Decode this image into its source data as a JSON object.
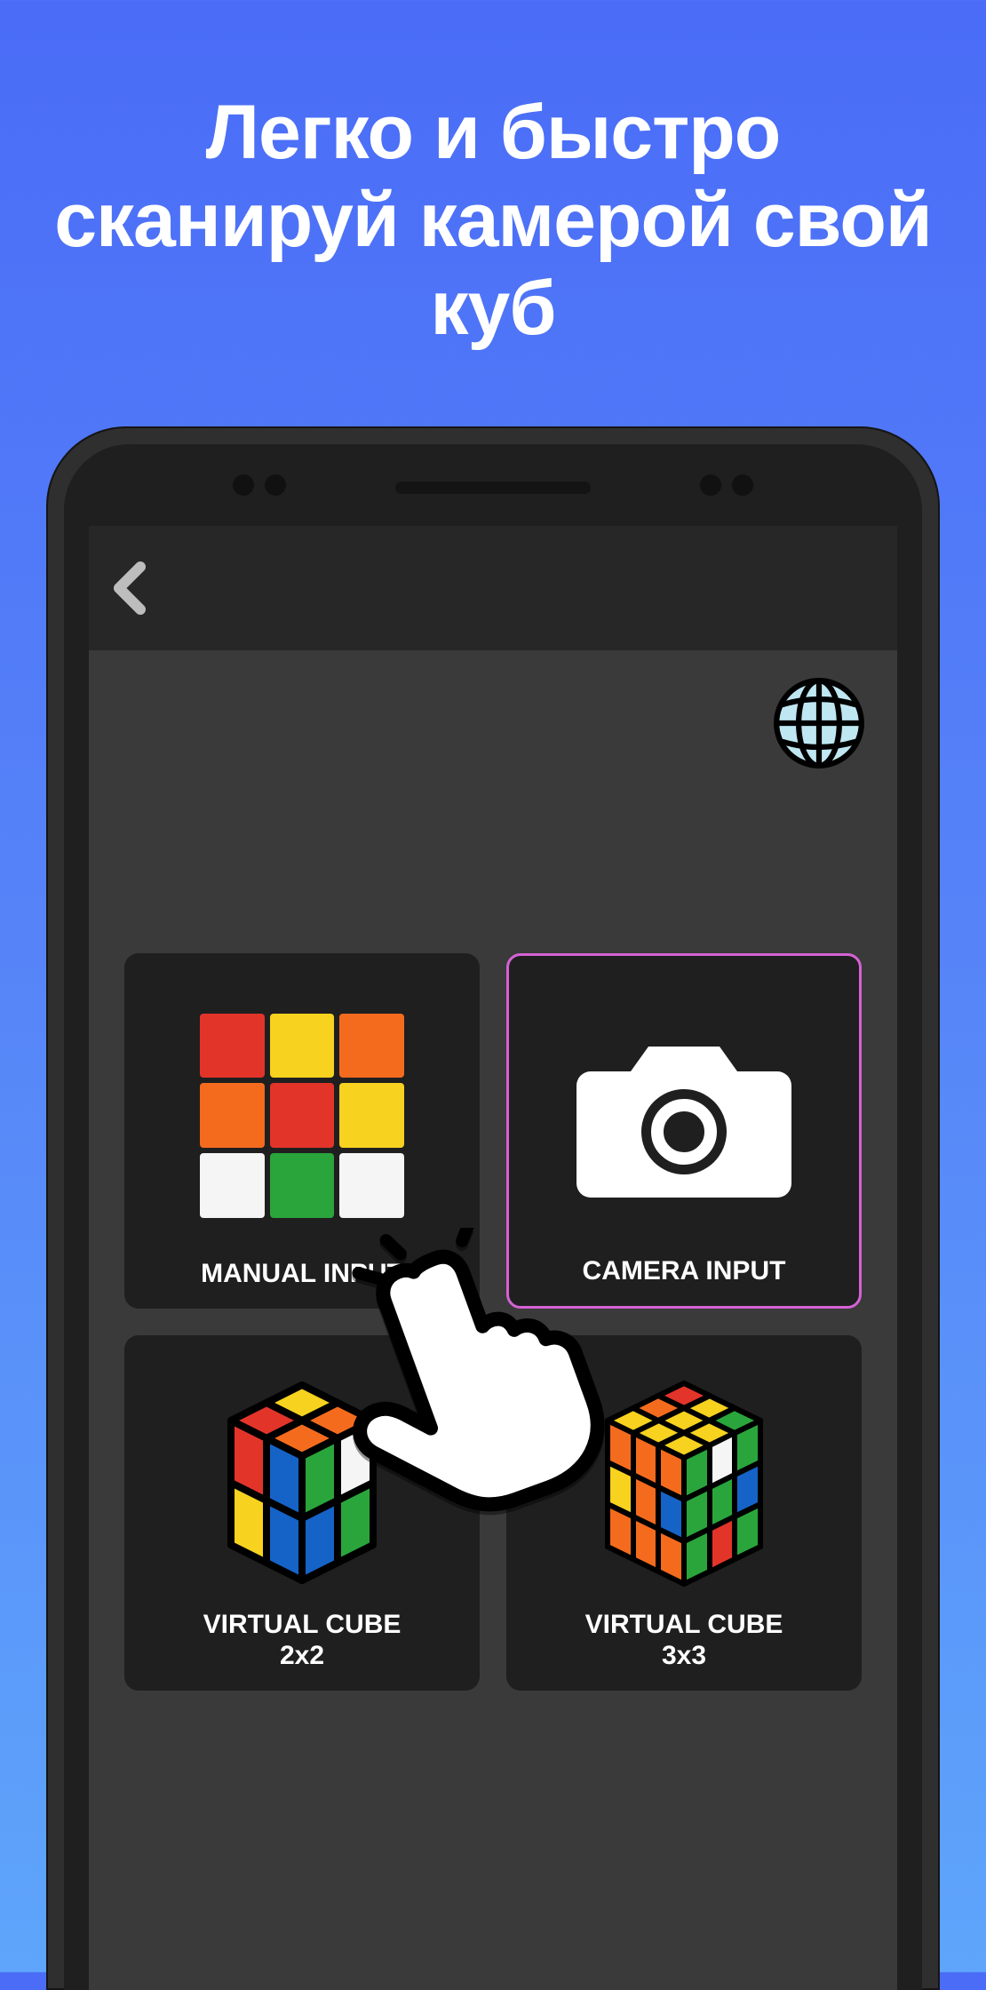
{
  "promo": {
    "headline": "Легко и быстро сканируй камерой свой куб"
  },
  "app": {
    "tiles": {
      "manual": "MANUAL INPUT",
      "camera": "CAMERA INPUT",
      "vc2": "VIRTUAL CUBE\n2x2",
      "vc3": "VIRTUAL CUBE\n3x3"
    },
    "icons": {
      "back": "back-icon",
      "globe": "globe-icon",
      "camera": "camera-icon",
      "hand": "hand-pointer-icon"
    },
    "cubeColors": {
      "red": "#e3342a",
      "yellow": "#f7d21e",
      "orange": "#f56b1e",
      "green": "#2aa53b",
      "blue": "#1663c7",
      "white": "#f5f5f5"
    },
    "manualFace": [
      "red",
      "yellow",
      "orange",
      "orange",
      "red",
      "yellow",
      "white",
      "green",
      "white"
    ]
  }
}
